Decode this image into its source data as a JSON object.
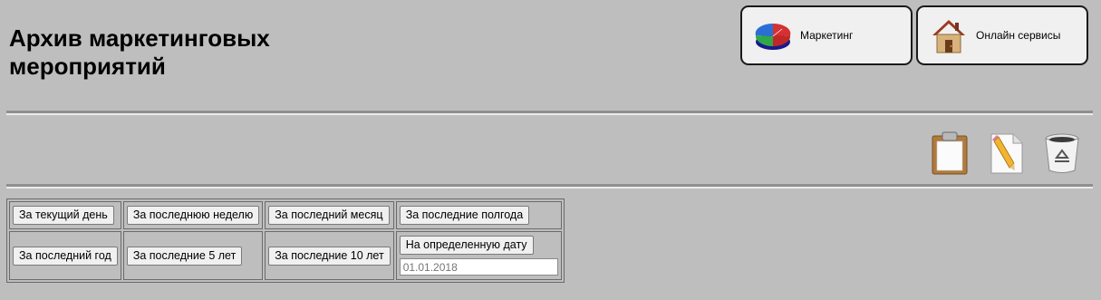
{
  "header": {
    "title": "Архив маркетинговых мероприятий"
  },
  "nav": {
    "marketing": {
      "label": "Маркетинг",
      "icon": "pie-chart-icon"
    },
    "online": {
      "label": "Онлайн сервисы",
      "icon": "house-icon"
    }
  },
  "toolbar": {
    "icons": [
      "clipboard-icon",
      "edit-document-icon",
      "recycle-bin-icon"
    ]
  },
  "filters": {
    "rows": [
      [
        "За текущий день",
        "За последнюю неделю",
        "За последний месяц",
        "За последние полгода"
      ],
      [
        "За последний год",
        "За последние 5 лет",
        "За последние 10 лет",
        "На определенную дату"
      ]
    ],
    "date": {
      "placeholder": "01.01.2018"
    }
  },
  "colors": {
    "background": "#bebebe",
    "button": "#f0f0f0",
    "divider": "#8f8f8f"
  }
}
